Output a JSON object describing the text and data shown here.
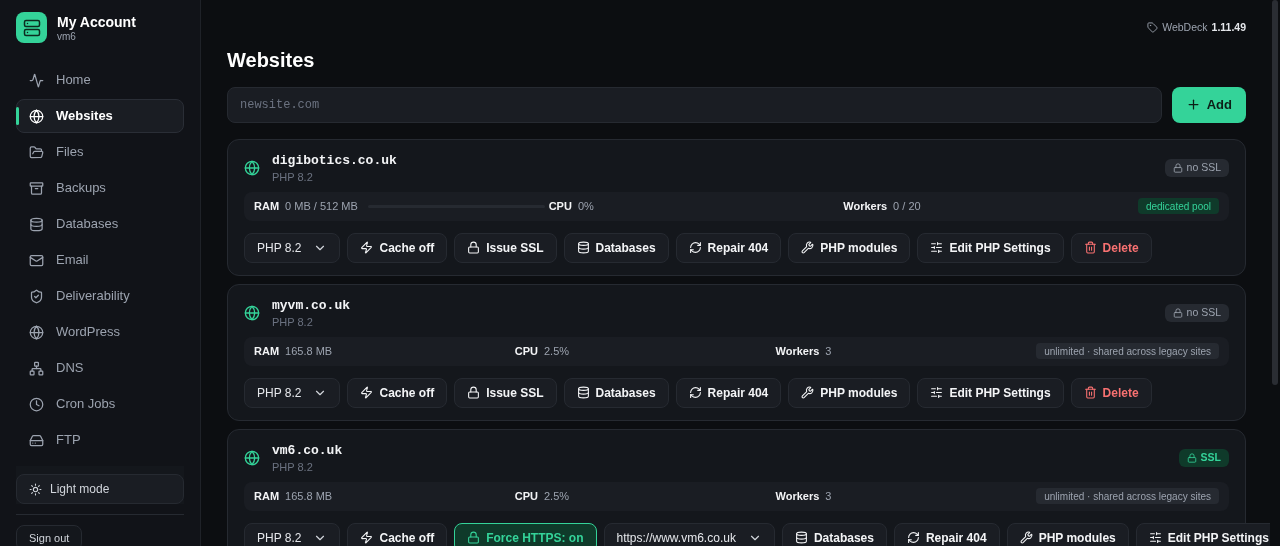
{
  "account": {
    "title": "My Account",
    "subtitle": "vm6"
  },
  "sidebar": {
    "items": [
      {
        "label": "Home",
        "selected": false
      },
      {
        "label": "Websites",
        "selected": true
      },
      {
        "label": "Files",
        "selected": false
      },
      {
        "label": "Backups",
        "selected": false
      },
      {
        "label": "Databases",
        "selected": false
      },
      {
        "label": "Email",
        "selected": false
      },
      {
        "label": "Deliverability",
        "selected": false
      },
      {
        "label": "WordPress",
        "selected": false
      },
      {
        "label": "DNS",
        "selected": false
      },
      {
        "label": "Cron Jobs",
        "selected": false
      },
      {
        "label": "FTP",
        "selected": false
      }
    ],
    "theme_button": "Light mode",
    "sign_out": "Sign out"
  },
  "version": {
    "product": "WebDeck",
    "number": "1.11.49"
  },
  "page_title": "Websites",
  "new_site": {
    "placeholder": "newsite.com",
    "button": "Add"
  },
  "sites": [
    {
      "domain": "digibotics.co.uk",
      "php": "PHP 8.2",
      "ssl": {
        "label": "no SSL",
        "secure": false
      },
      "stats": {
        "ram_label": "RAM",
        "ram": "0 MB / 512 MB",
        "ram_bar": {
          "level": 0
        },
        "cpu_label": "CPU",
        "cpu": "0%",
        "workers_label": "Workers",
        "workers": "0 / 20",
        "pool": {
          "label": "dedicated pool",
          "kind": "dedicated"
        }
      },
      "actions": [
        {
          "kind": "select",
          "label": "PHP 8.2"
        },
        {
          "kind": "cache",
          "label": "Cache off"
        },
        {
          "kind": "ssl",
          "label": "Issue SSL"
        },
        {
          "kind": "databases",
          "label": "Databases"
        },
        {
          "kind": "repair",
          "label": "Repair 404"
        },
        {
          "kind": "modules",
          "label": "PHP modules"
        },
        {
          "kind": "settings",
          "label": "Edit PHP Settings"
        },
        {
          "kind": "delete",
          "label": "Delete"
        }
      ]
    },
    {
      "domain": "myvm.co.uk",
      "php": "PHP 8.2",
      "ssl": {
        "label": "no SSL",
        "secure": false
      },
      "stats": {
        "ram_label": "RAM",
        "ram": "165.8 MB",
        "cpu_label": "CPU",
        "cpu": "2.5%",
        "workers_label": "Workers",
        "workers": "3",
        "pool": {
          "label": "unlimited · shared across legacy sites",
          "kind": "shared"
        }
      },
      "actions": [
        {
          "kind": "select",
          "label": "PHP 8.2"
        },
        {
          "kind": "cache",
          "label": "Cache off"
        },
        {
          "kind": "ssl",
          "label": "Issue SSL"
        },
        {
          "kind": "databases",
          "label": "Databases"
        },
        {
          "kind": "repair",
          "label": "Repair 404"
        },
        {
          "kind": "modules",
          "label": "PHP modules"
        },
        {
          "kind": "settings",
          "label": "Edit PHP Settings"
        },
        {
          "kind": "delete",
          "label": "Delete"
        }
      ]
    },
    {
      "domain": "vm6.co.uk",
      "php": "PHP 8.2",
      "ssl": {
        "label": "SSL",
        "secure": true
      },
      "stats": {
        "ram_label": "RAM",
        "ram": "165.8 MB",
        "cpu_label": "CPU",
        "cpu": "2.5%",
        "workers_label": "Workers",
        "workers": "3",
        "pool": {
          "label": "unlimited · shared across legacy sites",
          "kind": "shared"
        }
      },
      "actions": [
        {
          "kind": "select",
          "label": "PHP 8.2"
        },
        {
          "kind": "cache",
          "label": "Cache off"
        },
        {
          "kind": "https",
          "label": "Force HTTPS: on",
          "on": true
        },
        {
          "kind": "select",
          "label": "https://www.vm6.co.uk"
        },
        {
          "kind": "databases",
          "label": "Databases"
        },
        {
          "kind": "repair",
          "label": "Repair 404"
        },
        {
          "kind": "modules",
          "label": "PHP modules"
        },
        {
          "kind": "settings",
          "label": "Edit PHP Settings"
        }
      ]
    }
  ]
}
